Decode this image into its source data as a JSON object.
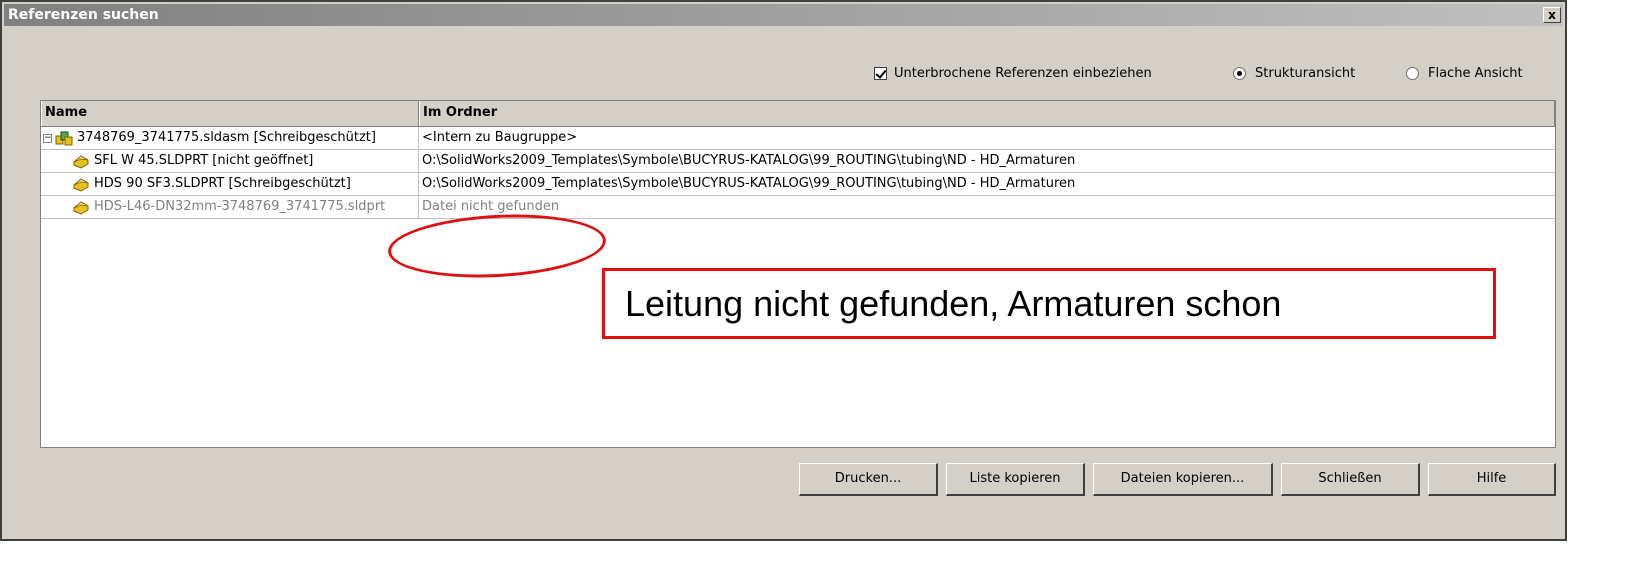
{
  "window": {
    "title": "Referenzen suchen",
    "close_label": "x"
  },
  "options": {
    "include_broken_refs": {
      "label": "Unterbrochene Referenzen einbeziehen",
      "checked": true
    },
    "tree_view": {
      "label": "Strukturansicht",
      "selected": true
    },
    "flat_view": {
      "label": "Flache Ansicht",
      "selected": false
    }
  },
  "list": {
    "columns": {
      "name": "Name",
      "folder": "Im Ordner"
    },
    "rows": [
      {
        "name": "3748769_3741775.sldasm  [Schreibgeschützt]",
        "folder": "<Intern zu Baugruppe>",
        "expander": "−",
        "icon": "assembly-icon"
      },
      {
        "name": "SFL W 45.SLDPRT [nicht geöffnet]",
        "folder": "O:\\SolidWorks2009_Templates\\Symbole\\BUCYRUS-KATALOG\\99_ROUTING\\tubing\\ND - HD_Armaturen",
        "icon": "part-icon"
      },
      {
        "name": "HDS 90 SF3.SLDPRT  [Schreibgeschützt]",
        "folder": "O:\\SolidWorks2009_Templates\\Symbole\\BUCYRUS-KATALOG\\99_ROUTING\\tubing\\ND - HD_Armaturen",
        "icon": "part-icon"
      },
      {
        "name": "HDS-L46-DN32mm-3748769_3741775.sldprt",
        "folder": "Datei nicht gefunden",
        "icon": "part-icon",
        "missing": true
      }
    ]
  },
  "buttons": {
    "print": "Drucken...",
    "copy_list": "Liste kopieren",
    "copy_files": "Dateien kopieren...",
    "close": "Schließen",
    "help": "Hilfe"
  },
  "annotation": {
    "text": "Leitung nicht gefunden, Armaturen schon",
    "color": "#e01010"
  }
}
